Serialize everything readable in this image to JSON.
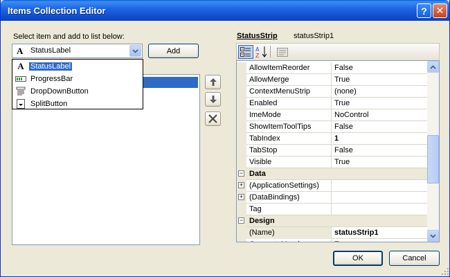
{
  "window": {
    "title": "Items Collection Editor",
    "help_glyph": "?",
    "close_glyph": "✕"
  },
  "left": {
    "select_label": "Select item and add to list below:",
    "combo": {
      "glyph": "A",
      "value": "StatusLabel",
      "icon": "chevron-down-icon"
    },
    "add_button": "Add",
    "dropdown_options": [
      {
        "label": "StatusLabel",
        "icon": "status-label-icon",
        "glyph": "A",
        "selected": true
      },
      {
        "label": "ProgressBar",
        "icon": "progress-bar-icon",
        "selected": false
      },
      {
        "label": "DropDownButton",
        "icon": "drop-down-button-icon",
        "selected": false
      },
      {
        "label": "SplitButton",
        "icon": "split-button-icon",
        "selected": false
      }
    ],
    "side_buttons": [
      {
        "icon": "arrow-up-icon"
      },
      {
        "icon": "arrow-down-icon"
      },
      {
        "icon": "delete-x-icon"
      }
    ]
  },
  "right": {
    "object_type": "StatusStrip",
    "object_name": "statusStrip1",
    "toolbar": [
      {
        "icon": "categorized-icon",
        "active": true
      },
      {
        "icon": "alphabetical-icon",
        "active": false
      },
      {
        "icon": "property-pages-icon",
        "active": false
      }
    ],
    "rows": [
      {
        "kind": "prop",
        "name": "AllowItemReorder",
        "value": "False",
        "bold": false
      },
      {
        "kind": "prop",
        "name": "AllowMerge",
        "value": "True",
        "bold": false
      },
      {
        "kind": "prop",
        "name": "ContextMenuStrip",
        "value": "(none)",
        "bold": false
      },
      {
        "kind": "prop",
        "name": "Enabled",
        "value": "True",
        "bold": false
      },
      {
        "kind": "prop",
        "name": "ImeMode",
        "value": "NoControl",
        "bold": false
      },
      {
        "kind": "prop",
        "name": "ShowItemToolTips",
        "value": "False",
        "bold": false
      },
      {
        "kind": "prop",
        "name": "TabIndex",
        "value": "1",
        "bold": true
      },
      {
        "kind": "prop",
        "name": "TabStop",
        "value": "False",
        "bold": false
      },
      {
        "kind": "prop",
        "name": "Visible",
        "value": "True",
        "bold": false
      },
      {
        "kind": "cat",
        "name": "Data",
        "expander": "−"
      },
      {
        "kind": "prop",
        "name": "(ApplicationSettings)",
        "value": "",
        "bold": false,
        "expander": "+"
      },
      {
        "kind": "prop",
        "name": "(DataBindings)",
        "value": "",
        "bold": false,
        "expander": "+"
      },
      {
        "kind": "prop",
        "name": "Tag",
        "value": "",
        "bold": false
      },
      {
        "kind": "cat",
        "name": "Design",
        "expander": "−"
      },
      {
        "kind": "prop",
        "name": "(Name)",
        "value": "statusStrip1",
        "bold": true,
        "selected": true
      },
      {
        "kind": "prop",
        "name": "GenerateMember",
        "value": "True",
        "bold": false
      }
    ]
  },
  "footer": {
    "ok": "OK",
    "cancel": "Cancel"
  }
}
